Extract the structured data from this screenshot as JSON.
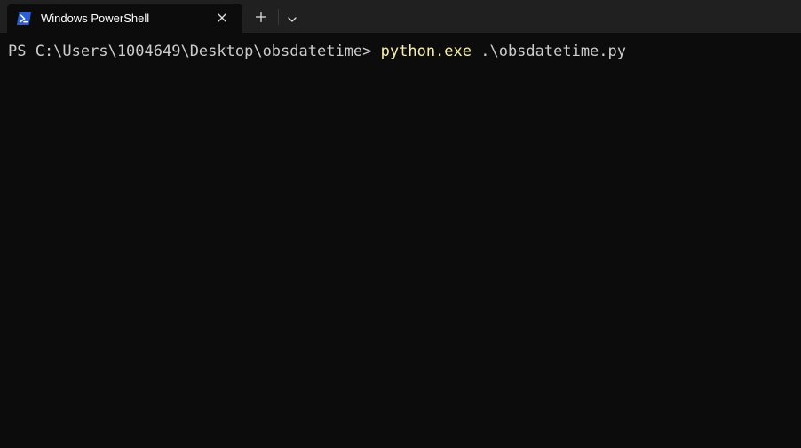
{
  "tab": {
    "title": "Windows PowerShell",
    "icon": "powershell-icon",
    "close_icon": "close-icon"
  },
  "toolbar": {
    "new_tab_icon": "plus-icon",
    "dropdown_icon": "chevron-down-icon"
  },
  "terminal": {
    "prompt": "PS C:\\Users\\1004649\\Desktop\\obsdatetime> ",
    "command": "python.exe",
    "argument": " .\\obsdatetime.py"
  },
  "colors": {
    "background": "#0c0c0c",
    "tabstrip": "#202020",
    "text": "#cccccc",
    "command": "#f9f1a5",
    "icon_blue": "#2b5fd9"
  }
}
